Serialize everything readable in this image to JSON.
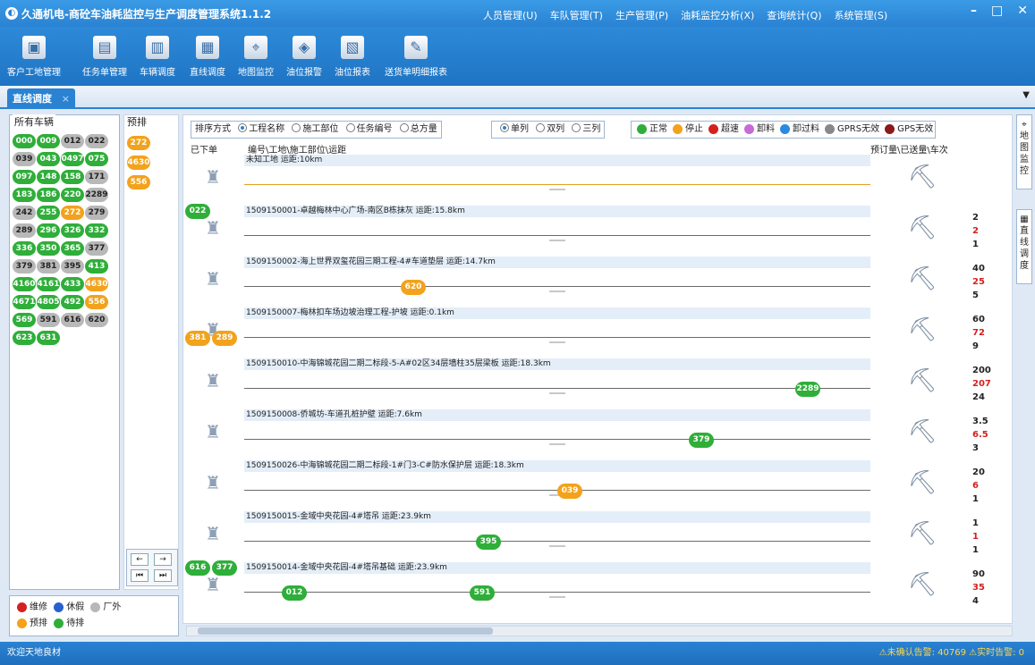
{
  "window": {
    "title": "久通机电-商砼车油耗监控与生产调度管理系统1.1.2",
    "menus": [
      "人员管理(U)",
      "车队管理(T)",
      "生产管理(P)",
      "油耗监控分析(X)",
      "查询统计(Q)",
      "系统管理(S)"
    ],
    "controls": [
      "–",
      "□",
      "✕"
    ]
  },
  "toolbar": [
    {
      "label": "客户工地管理",
      "icon": "briefcase-icon"
    },
    {
      "label": "任务单管理",
      "icon": "ledger-icon"
    },
    {
      "label": "车辆调度",
      "icon": "truck-icon"
    },
    {
      "label": "直线调度",
      "icon": "monitor-icon"
    },
    {
      "label": "地图监控",
      "icon": "map-icon"
    },
    {
      "label": "油位报警",
      "icon": "alarm-icon"
    },
    {
      "label": "油位报表",
      "icon": "fuel-report-icon"
    },
    {
      "label": "送货单明细报表",
      "icon": "delivery-report-icon"
    }
  ],
  "tab": {
    "label": "直线调度",
    "close": "×"
  },
  "left_panel": {
    "title": "所有车辆",
    "vehicles": [
      [
        "000",
        "g"
      ],
      [
        "009",
        "g"
      ],
      [
        "012",
        "gr"
      ],
      [
        "022",
        "gr"
      ],
      [
        "039",
        "gr"
      ],
      [
        "043",
        "g"
      ],
      [
        "0497",
        "g"
      ],
      [
        "075",
        "g"
      ],
      [
        "097",
        "g"
      ],
      [
        "148",
        "g"
      ],
      [
        "158",
        "g"
      ],
      [
        "171",
        "gr"
      ],
      [
        "183",
        "g"
      ],
      [
        "186",
        "g"
      ],
      [
        "220",
        "g"
      ],
      [
        "2289",
        "gr"
      ],
      [
        "242",
        "gr"
      ],
      [
        "255",
        "g"
      ],
      [
        "272",
        "o"
      ],
      [
        "279",
        "gr"
      ],
      [
        "289",
        "gr"
      ],
      [
        "296",
        "g"
      ],
      [
        "326",
        "g"
      ],
      [
        "332",
        "g"
      ],
      [
        "336",
        "g"
      ],
      [
        "350",
        "g"
      ],
      [
        "365",
        "g"
      ],
      [
        "377",
        "gr"
      ],
      [
        "379",
        "gr"
      ],
      [
        "381",
        "gr"
      ],
      [
        "395",
        "gr"
      ],
      [
        "413",
        "g"
      ],
      [
        "4160",
        "g"
      ],
      [
        "4161",
        "g"
      ],
      [
        "433",
        "g"
      ],
      [
        "4630",
        "o"
      ],
      [
        "4671",
        "g"
      ],
      [
        "4805",
        "g"
      ],
      [
        "492",
        "g"
      ],
      [
        "556",
        "o"
      ],
      [
        "569",
        "g"
      ],
      [
        "591",
        "gr"
      ],
      [
        "616",
        "gr"
      ],
      [
        "620",
        "gr"
      ],
      [
        "623",
        "g"
      ],
      [
        "631",
        "g"
      ]
    ]
  },
  "mid_panel": {
    "title": "预排",
    "vehicles": [
      [
        "272",
        "o"
      ],
      [
        "4630",
        "o"
      ],
      [
        "556",
        "o"
      ]
    ],
    "nav": [
      "←",
      "→",
      "⏮",
      "⏭"
    ]
  },
  "legend": {
    "row1": [
      {
        "label": "维修",
        "color": "#d42020"
      },
      {
        "label": "休假",
        "color": "#2a5fd0"
      },
      {
        "label": "厂外",
        "color": "#b8b8b8"
      }
    ],
    "row2": [
      {
        "label": "预排",
        "color": "#f2a21c"
      },
      {
        "label": "待排",
        "color": "#2fae3a"
      }
    ]
  },
  "sort": {
    "label": "排序方式",
    "options": [
      "工程名称",
      "施工部位",
      "任务编号",
      "总方量"
    ],
    "selected": 0
  },
  "columns": {
    "options": [
      "单列",
      "双列",
      "三列"
    ],
    "selected": 0
  },
  "status_legend": [
    {
      "label": "正常",
      "color": "#2fae3a"
    },
    {
      "label": "停止",
      "color": "#f2a21c"
    },
    {
      "label": "超速",
      "color": "#d42020"
    },
    {
      "label": "卸料",
      "color": "#c86ad8"
    },
    {
      "label": "卸过料",
      "color": "#2a8ae0"
    },
    {
      "label": "GPRS无效",
      "color": "#888888"
    },
    {
      "label": "GPS无效",
      "color": "#8b1a1a"
    }
  ],
  "headers": {
    "left": "已下单",
    "mid": "编号\\工地\\施工部位\\运距",
    "right": "预订量\\已送量\\车次"
  },
  "rows": [
    {
      "label": "未知工地 运距:10km",
      "nums": [
        "",
        "",
        ""
      ],
      "line_color": "#e2a21c",
      "pills": [],
      "left_pills": []
    },
    {
      "label": "1509150001-卓越梅林中心广场-南区B栋抹灰 运距:15.8km",
      "nums": [
        "2",
        "2",
        "1"
      ],
      "line_color": "#6a6a6a",
      "pills": [],
      "left_pills": [
        [
          "022",
          "g"
        ]
      ]
    },
    {
      "label": "1509150002-海上世界双玺花园三期工程-4#车道垫层 运距:14.7km",
      "nums": [
        "40",
        "25",
        "5"
      ],
      "line_color": "#6a6a6a",
      "pills": [
        [
          "620",
          "o",
          0.27
        ]
      ],
      "left_pills": []
    },
    {
      "label": "1509150007-梅林扣车场边坡治理工程-护坡 运距:0.1km",
      "nums": [
        "60",
        "72",
        "9"
      ],
      "line_color": "#6a6a6a",
      "pills": [],
      "left_pills": [
        [
          "381",
          "o"
        ],
        [
          "289",
          "o"
        ]
      ]
    },
    {
      "label": "1509150010-中海锦城花园二期二标段-5-A#02区34层墙柱35层梁板 运距:18.3km",
      "nums": [
        "200",
        "207",
        "24"
      ],
      "line_color": "#6a6a6a",
      "pills": [
        [
          "2289",
          "g",
          0.9
        ]
      ],
      "left_pills": []
    },
    {
      "label": "1509150008-侨城坊-车道孔桩护壁 运距:7.6km",
      "nums": [
        "3.5",
        "6.5",
        "3"
      ],
      "line_color": "#6a6a6a",
      "pills": [
        [
          "379",
          "g",
          0.73
        ]
      ],
      "left_pills": []
    },
    {
      "label": "1509150026-中海锦城花园二期二标段-1#门3-C#防水保护层 运距:18.3km",
      "nums": [
        "20",
        "6",
        "1"
      ],
      "line_color": "#6a6a6a",
      "pills": [
        [
          "039",
          "o",
          0.52
        ]
      ],
      "left_pills": []
    },
    {
      "label": "1509150015-金域中央花园-4#塔吊 运距:23.9km",
      "nums": [
        "1",
        "1",
        "1"
      ],
      "line_color": "#6a6a6a",
      "pills": [
        [
          "395",
          "g",
          0.39
        ]
      ],
      "left_pills": []
    },
    {
      "label": "1509150014-金域中央花园-4#塔吊基础 运距:23.9km",
      "nums": [
        "90",
        "35",
        "4"
      ],
      "line_color": "#6a6a6a",
      "pills": [
        [
          "012",
          "g",
          0.08
        ],
        [
          "591",
          "g",
          0.38
        ]
      ],
      "left_pills": [
        [
          "616",
          "g"
        ],
        [
          "377",
          "g"
        ]
      ]
    }
  ],
  "right_tabs": [
    "地图监控",
    "直线调度"
  ],
  "status": {
    "left": "欢迎天地良材",
    "right": "⚠未确认告警: 40769 ⚠实时告警: 0"
  }
}
